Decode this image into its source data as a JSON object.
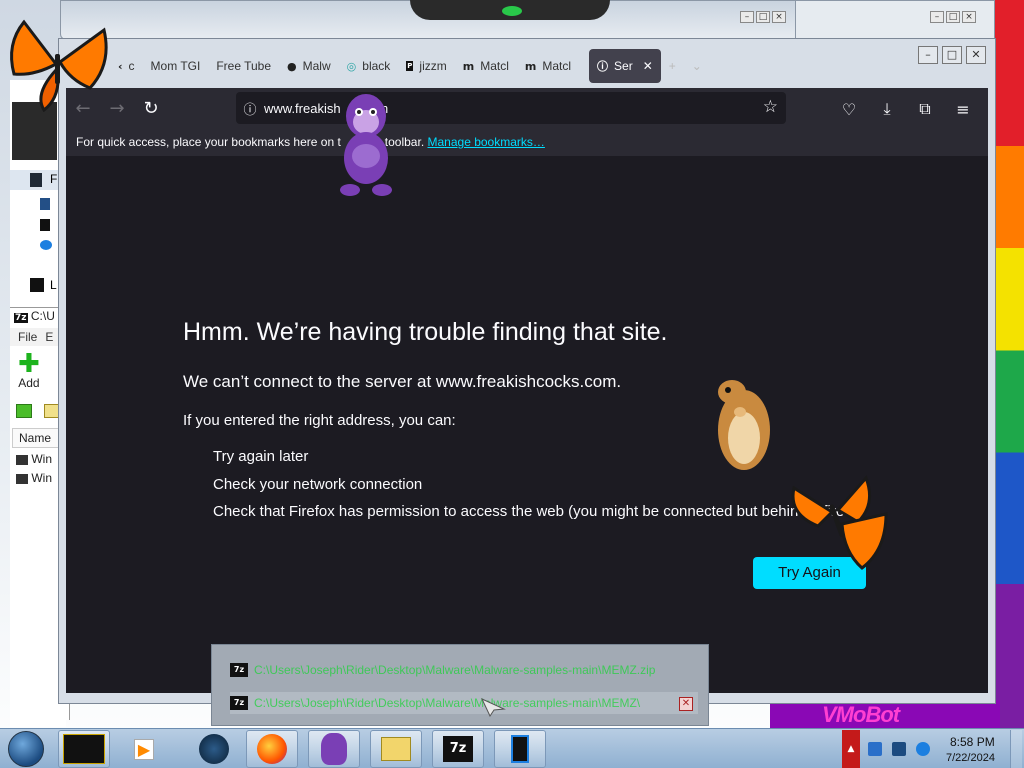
{
  "desktop": {
    "wallpaper_text": "VMoBot"
  },
  "explorer_window": {
    "rows": [
      "F",
      "L"
    ]
  },
  "sevenzip": {
    "title": "C:\\U",
    "menu": [
      "File",
      "E"
    ],
    "add_label": "Add",
    "column_name": "Name",
    "files": [
      "Win",
      "Win"
    ]
  },
  "firefox": {
    "tabs": [
      {
        "label": "c",
        "icon": "tab-icon"
      },
      {
        "label": "Mom TGI",
        "icon": "none"
      },
      {
        "label": "Free Tube",
        "icon": "none"
      },
      {
        "label": "Malw",
        "icon": "github-icon"
      },
      {
        "label": "black",
        "icon": "globe-icon"
      },
      {
        "label": "jizzm",
        "icon": "site-icon"
      },
      {
        "label": "Matcl",
        "icon": "site-icon"
      },
      {
        "label": "Matcl",
        "icon": "site-icon"
      }
    ],
    "active_tab": {
      "label": "Ser",
      "icon": "info-icon"
    },
    "url": "www.freakish   .com",
    "bookmarks_message": "For quick access, place your bookmarks here on t   arks toolbar.",
    "bookmarks_link": "Manage bookmarks…"
  },
  "error_page": {
    "title": "Hmm. We’re having trouble finding that site.",
    "subtitle": "We can’t connect to the server at www.freakishcocks.com.",
    "advice_heading": "If you entered the right address, you can:",
    "advice_items": [
      "Try again later",
      "Check your network connection",
      "Check that Firefox has permission to access the web (you might be connected but behind a fire"
    ],
    "try_again_label": "Try Again"
  },
  "zip_popup": {
    "row1": "C:\\Users\\Joseph\\Rider\\Desktop\\Malware\\Malware-samples-main\\MEMZ.zip",
    "row2": "C:\\Users\\Joseph\\Rider\\Desktop\\Malware\\Malware-samples-main\\MEMZ\\"
  },
  "taskbar": {
    "clock_time": "8:58 PM",
    "clock_date": "7/22/2024",
    "items": [
      "black-window",
      "media-player",
      "globe-app",
      "firefox",
      "bonzi-buddy",
      "file-explorer",
      "7-zip",
      "tablet-app"
    ]
  },
  "colors": {
    "accent": "#00ddff",
    "content_bg": "#1c1b22",
    "toolbar_bg": "#2b2a33"
  }
}
